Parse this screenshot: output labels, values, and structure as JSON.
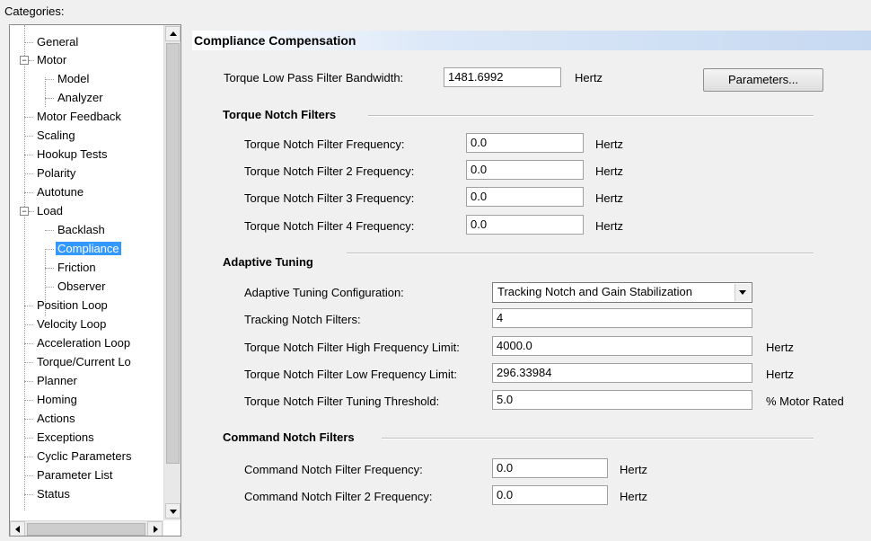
{
  "categories_label": "Categories:",
  "tree": {
    "items": [
      {
        "label": "General"
      },
      {
        "label": "Motor",
        "expander": "−"
      },
      {
        "label": "Model"
      },
      {
        "label": "Analyzer"
      },
      {
        "label": "Motor Feedback"
      },
      {
        "label": "Scaling"
      },
      {
        "label": "Hookup Tests"
      },
      {
        "label": "Polarity"
      },
      {
        "label": "Autotune"
      },
      {
        "label": "Load",
        "expander": "−"
      },
      {
        "label": "Backlash"
      },
      {
        "label": "Compliance",
        "selected": true
      },
      {
        "label": "Friction"
      },
      {
        "label": "Observer"
      },
      {
        "label": "Position Loop"
      },
      {
        "label": "Velocity Loop"
      },
      {
        "label": "Acceleration Loop"
      },
      {
        "label": "Torque/Current Lo"
      },
      {
        "label": "Planner"
      },
      {
        "label": "Homing"
      },
      {
        "label": "Actions"
      },
      {
        "label": "Exceptions"
      },
      {
        "label": "Cyclic Parameters"
      },
      {
        "label": "Parameter List"
      },
      {
        "label": "Status"
      }
    ]
  },
  "header": {
    "title": "Compliance Compensation"
  },
  "top": {
    "bandwidth_label": "Torque Low Pass Filter Bandwidth:",
    "bandwidth_value": "1481.6992",
    "bandwidth_unit": "Hertz",
    "parameters_button": "Parameters..."
  },
  "notch": {
    "title": "Torque Notch Filters",
    "f1_label": "Torque Notch Filter Frequency:",
    "f1_value": "0.0",
    "f1_unit": "Hertz",
    "f2_label": "Torque Notch Filter 2 Frequency:",
    "f2_value": "0.0",
    "f2_unit": "Hertz",
    "f3_label": "Torque Notch Filter 3 Frequency:",
    "f3_value": "0.0",
    "f3_unit": "Hertz",
    "f4_label": "Torque Notch Filter 4 Frequency:",
    "f4_value": "0.0",
    "f4_unit": "Hertz"
  },
  "adaptive": {
    "title": "Adaptive Tuning",
    "config_label": "Adaptive Tuning Configuration:",
    "config_value": "Tracking Notch and Gain Stabilization",
    "tracking_label": "Tracking Notch Filters:",
    "tracking_value": "4",
    "high_label": "Torque Notch Filter High Frequency Limit:",
    "high_value": "4000.0",
    "high_unit": "Hertz",
    "low_label": "Torque Notch Filter Low Frequency Limit:",
    "low_value": "296.33984",
    "low_unit": "Hertz",
    "thresh_label": "Torque Notch Filter Tuning Threshold:",
    "thresh_value": "5.0",
    "thresh_unit": "% Motor Rated"
  },
  "command": {
    "title": "Command Notch Filters",
    "f1_label": "Command Notch Filter Frequency:",
    "f1_value": "0.0",
    "f1_unit": "Hertz",
    "f2_label": "Command Notch Filter 2 Frequency:",
    "f2_value": "0.0",
    "f2_unit": "Hertz"
  }
}
